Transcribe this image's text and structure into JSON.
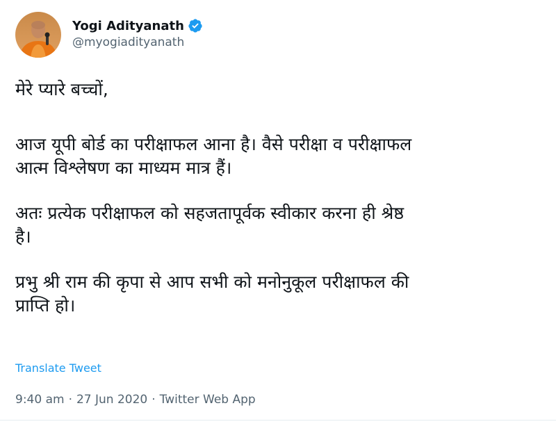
{
  "author": {
    "name": "Yogi Adityanath",
    "handle": "@myogiadityanath",
    "verified": true
  },
  "tweet": {
    "greeting": "मेरे प्यारे बच्चों,",
    "paragraph_1": [
      "आज यूपी बोर्ड का परीक्षाफल आना है। वैसे परीक्षा व परीक्षाफल",
      "आत्म विश्लेषण का माध्यम मात्र हैं।"
    ],
    "paragraph_2": [
      "अतः प्रत्येक परीक्षाफल को सहजतापूर्वक स्वीकार करना ही श्रेष्ठ",
      "है।"
    ],
    "paragraph_3": [
      "प्रभु श्री राम की कृपा से आप सभी को मनोनुकूल परीक्षाफल की",
      "प्राप्ति हो।"
    ]
  },
  "actions": {
    "translate_label": "Translate Tweet"
  },
  "meta": {
    "time": "9:40 am",
    "separator": "·",
    "date": "27 Jun 2020",
    "source": "Twitter Web App"
  },
  "colors": {
    "text": "#0f1419",
    "secondary": "#536471",
    "link": "#1d9bf0",
    "verified_badge": "#1d9bf0"
  }
}
